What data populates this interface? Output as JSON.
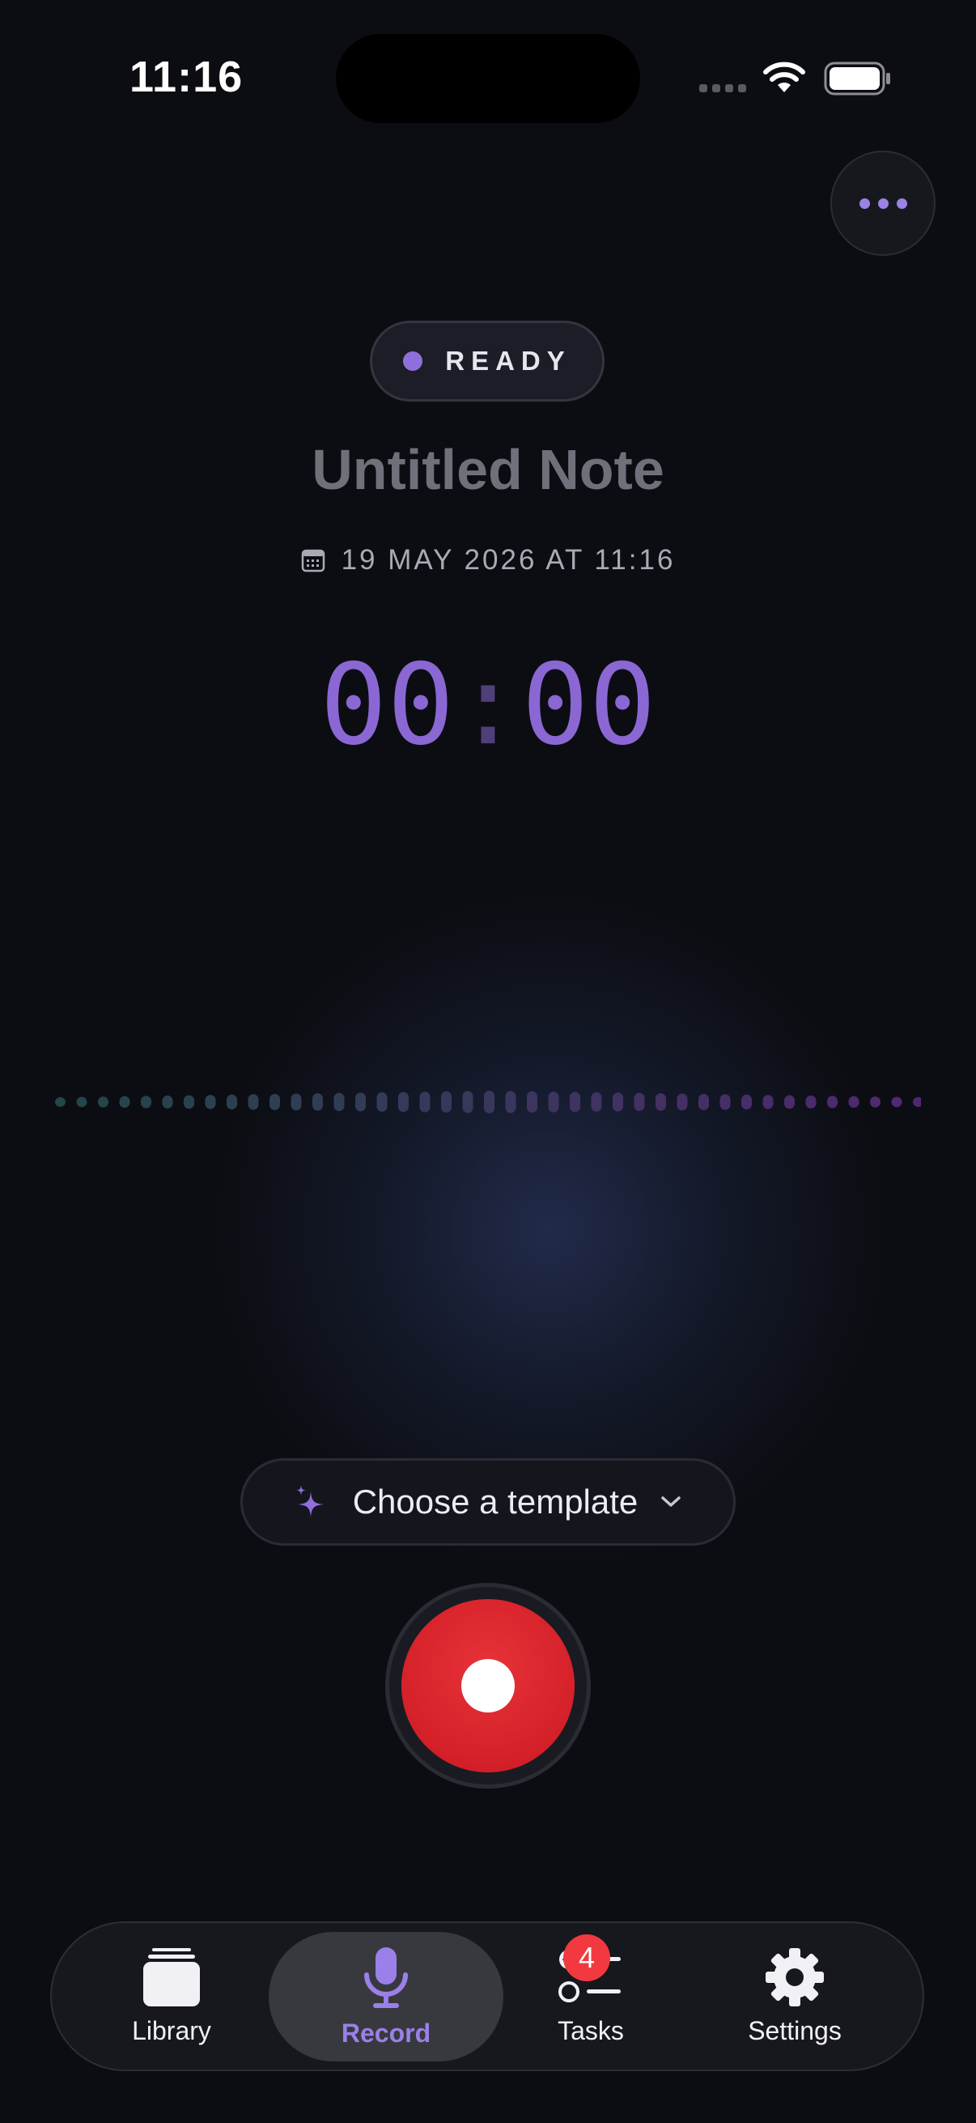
{
  "status_bar": {
    "time": "11:16"
  },
  "status": {
    "label": "READY"
  },
  "note": {
    "title": "Untitled Note",
    "date": "19 MAY 2026 AT 11:16"
  },
  "timer": {
    "minutes": "00",
    "separator": ":",
    "seconds": "00"
  },
  "template_picker": {
    "label": "Choose a template"
  },
  "tab_bar": {
    "items": [
      {
        "label": "Library",
        "icon": "library-icon"
      },
      {
        "label": "Record",
        "icon": "microphone-icon",
        "active": true
      },
      {
        "label": "Tasks",
        "icon": "tasks-icon",
        "badge": "4"
      },
      {
        "label": "Settings",
        "icon": "gear-icon"
      }
    ]
  },
  "colors": {
    "accent": "#8b67d4",
    "record": "#d42028",
    "badge": "#f2393f",
    "background": "#0c0d12"
  }
}
